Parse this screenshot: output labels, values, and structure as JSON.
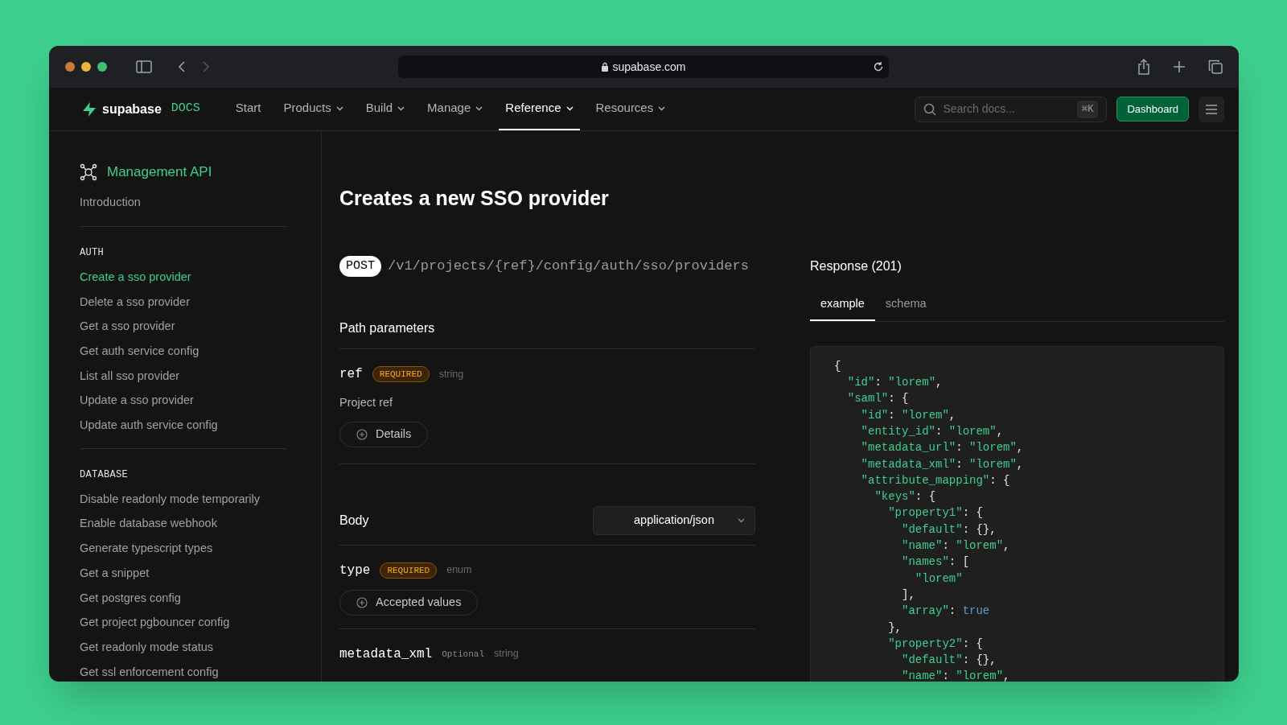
{
  "browser": {
    "url": "supabase.com"
  },
  "nav": {
    "brand": "supabase",
    "brand_tag": "DOCS",
    "items": [
      {
        "label": "Start",
        "dropdown": false,
        "selected": false
      },
      {
        "label": "Products",
        "dropdown": true,
        "selected": false
      },
      {
        "label": "Build",
        "dropdown": true,
        "selected": false
      },
      {
        "label": "Manage",
        "dropdown": true,
        "selected": false
      },
      {
        "label": "Reference",
        "dropdown": true,
        "selected": true
      },
      {
        "label": "Resources",
        "dropdown": true,
        "selected": false
      }
    ],
    "search": {
      "placeholder": "Search docs...",
      "shortcut": "⌘K"
    },
    "dashboard": "Dashboard"
  },
  "sidebar": {
    "title": "Management API",
    "intro": "Introduction",
    "sections": [
      {
        "heading": "AUTH",
        "items": [
          {
            "label": "Create a sso provider",
            "selected": true
          },
          {
            "label": "Delete a sso provider",
            "selected": false
          },
          {
            "label": "Get a sso provider",
            "selected": false
          },
          {
            "label": "Get auth service config",
            "selected": false
          },
          {
            "label": "List all sso provider",
            "selected": false
          },
          {
            "label": "Update a sso provider",
            "selected": false
          },
          {
            "label": "Update auth service config",
            "selected": false
          }
        ]
      },
      {
        "heading": "DATABASE",
        "items": [
          {
            "label": "Disable readonly mode temporarily",
            "selected": false
          },
          {
            "label": "Enable database webhook",
            "selected": false
          },
          {
            "label": "Generate typescript types",
            "selected": false
          },
          {
            "label": "Get a snippet",
            "selected": false
          },
          {
            "label": "Get postgres config",
            "selected": false
          },
          {
            "label": "Get project pgbouncer config",
            "selected": false
          },
          {
            "label": "Get readonly mode status",
            "selected": false
          },
          {
            "label": "Get ssl enforcement config",
            "selected": false
          }
        ]
      }
    ]
  },
  "endpoint": {
    "title": "Creates a new SSO provider",
    "method": "POST",
    "path": "/v1/projects/{ref}/config/auth/sso/providers",
    "path_parameters": {
      "heading": "Path parameters",
      "params": [
        {
          "name": "ref",
          "badge": "REQUIRED",
          "required": true,
          "type": "string",
          "description": "Project ref",
          "button": "Details"
        }
      ]
    },
    "body": {
      "heading": "Body",
      "content_type": "application/json",
      "params": [
        {
          "name": "type",
          "badge": "REQUIRED",
          "required": true,
          "type": "enum",
          "button": "Accepted values"
        },
        {
          "name": "metadata_xml",
          "badge": "Optional",
          "required": false,
          "type": "string"
        }
      ]
    }
  },
  "response": {
    "title": "Response (201)",
    "tabs": [
      {
        "label": "example",
        "selected": true
      },
      {
        "label": "schema",
        "selected": false
      }
    ],
    "code": [
      "{",
      "  \"id\": \"lorem\",",
      "  \"saml\": {",
      "    \"id\": \"lorem\",",
      "    \"entity_id\": \"lorem\",",
      "    \"metadata_url\": \"lorem\",",
      "    \"metadata_xml\": \"lorem\",",
      "    \"attribute_mapping\": {",
      "      \"keys\": {",
      "        \"property1\": {",
      "          \"default\": {},",
      "          \"name\": \"lorem\",",
      "          \"names\": [",
      "            \"lorem\"",
      "          ],",
      "          \"array\": true",
      "        },",
      "        \"property2\": {",
      "          \"default\": {},",
      "          \"name\": \"lorem\","
    ]
  }
}
